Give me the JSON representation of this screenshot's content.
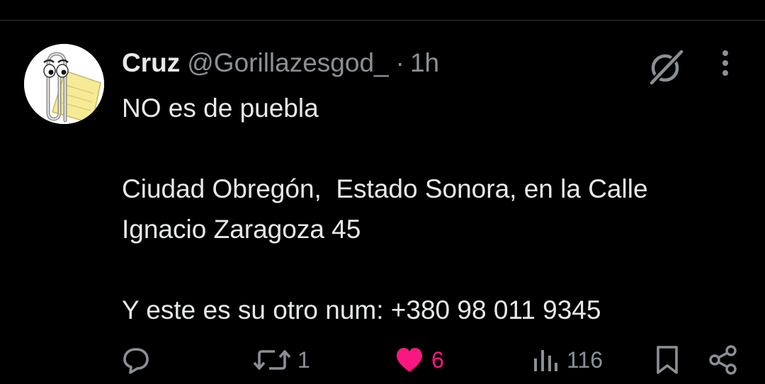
{
  "tweet": {
    "author": {
      "display_name": "Cruz",
      "handle": "@Gorillazesgod_",
      "avatar": "clippy-paperclip-avatar"
    },
    "separator": "·",
    "time": "1h",
    "text_lines": [
      "NO es de puebla",
      "",
      "Ciudad Obregón,  Estado Sonora, en la Calle",
      "Ignacio Zaragoza 45",
      "",
      "Y este es su otro num: +380 98 011 9345"
    ],
    "actions": {
      "reply": {
        "icon": "reply-bubble-icon",
        "count": ""
      },
      "retweet": {
        "icon": "retweet-icon",
        "count": "1"
      },
      "like": {
        "icon": "heart-icon",
        "count": "6",
        "active": true
      },
      "views": {
        "icon": "views-bar-icon",
        "count": "116"
      },
      "bookmark": {
        "icon": "bookmark-icon"
      },
      "share": {
        "icon": "share-icon"
      }
    },
    "header_icons": [
      "grok-icon",
      "more-vertical-icon"
    ]
  },
  "colors": {
    "background": "#000000",
    "text_primary": "#e7e9ea",
    "text_secondary": "#8b9096",
    "like_active": "#f91880",
    "divider": "#2f3336"
  }
}
